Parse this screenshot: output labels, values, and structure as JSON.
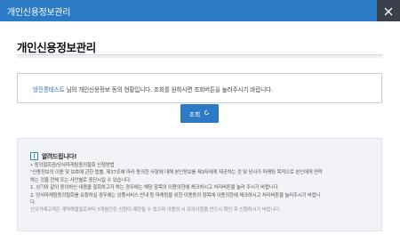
{
  "window": {
    "title": "개인신용정보관리",
    "close_icon": "close-icon"
  },
  "page": {
    "title": "개인신용정보관리"
  },
  "info": {
    "user_name": "방진롱테스트",
    "message": " 님의 개인신용정보 동의 현황입니다. 조회를 원하시면 조회버튼을 눌러주시기 바랍니다."
  },
  "query_button": {
    "label": "조회",
    "icon": "circle-arrow-icon"
  },
  "notice": {
    "icon": "info-icon",
    "heading": "알려드립니다!",
    "lines": [
      "• 동의철회권/당사마케팅동의철회 신청방법",
      "\"신용정보의 이용 및 보호에 관한 법률, 제37조에 따라 동의한 사항에 대해 본인정보를 제3자에게 제공하는 것 및 당사가 마케팅 목적으로 본인에게 연락",
      "하는 것을 전체 또는 사안별로 중단시킬 수 있습니다.",
      "1. 상기와 같이 동의하신 내용을 철회하고자 하는 경우에는 해당 항목의 이용의한에 체크하시고 처리버튼을 눌러 주시기 바랍니다.",
      "2. 당사마케팅동의철회를 요청하실 경우에는 상품서비스 안내 등 마케팅을 위한 이용동의 항목에 이용의한에 체크하시고 처리버튼을 눌러주시기 바랍니",
      "다.",
      "신규거래고객은 계약해결일로부터 3개월간은 신청이 제한될 수 있으며 이용의 시 유의사항을 반드시 확인 후 신청하시기 바랍니다."
    ]
  },
  "colors": {
    "brand": "#2c79c5",
    "close_bg": "#3a3f4a",
    "link": "#2f6fc0"
  }
}
